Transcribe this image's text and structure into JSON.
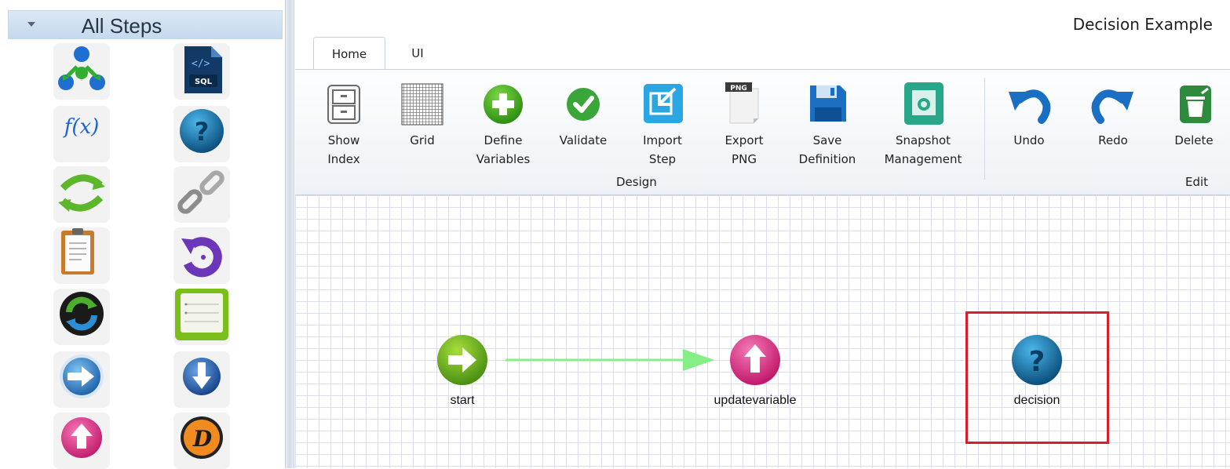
{
  "sidebar": {
    "header_title": "All Steps",
    "items": [
      {
        "icon": "hierarchy-icon"
      },
      {
        "icon": "sql-file-icon"
      },
      {
        "icon": "function-fx-icon",
        "text": "f(x)"
      },
      {
        "icon": "question-decision-icon"
      },
      {
        "icon": "loop-arrows-icon"
      },
      {
        "icon": "chain-link-icon"
      },
      {
        "icon": "clipboard-icon"
      },
      {
        "icon": "undo-rotate-icon"
      },
      {
        "icon": "sync-icon"
      },
      {
        "icon": "list-icon"
      },
      {
        "icon": "forward-arrow-icon"
      },
      {
        "icon": "down-arrow-icon"
      },
      {
        "icon": "up-arrow-icon"
      },
      {
        "icon": "d-badge-icon",
        "text": "D"
      }
    ],
    "sql_badge": "SQL"
  },
  "document": {
    "title": "Decision Example"
  },
  "tabs": [
    {
      "label": "Home",
      "active": true
    },
    {
      "label": "UI",
      "active": false
    }
  ],
  "ribbon": {
    "design_group_label": "Design",
    "edit_group_label": "Edit",
    "buttons": {
      "show_index": "Show\nIndex",
      "grid": "Grid",
      "define_variables": "Define\nVariables",
      "validate": "Validate",
      "import_step": "Import\nStep",
      "export_png": "Export\nPNG",
      "save_definition": "Save\nDefinition",
      "snapshot_management": "Snapshot\nManagement",
      "undo": "Undo",
      "redo": "Redo",
      "delete": "Delete"
    },
    "png_badge": "PNG"
  },
  "canvas": {
    "nodes": [
      {
        "label": "start",
        "icon": "start-arrow-icon"
      },
      {
        "label": "updatevariable",
        "icon": "up-arrow-icon"
      },
      {
        "label": "decision",
        "icon": "question-decision-icon",
        "selected": true
      }
    ]
  },
  "colors": {
    "accent_blue": "#1a6fc2",
    "selection_red": "#d81e2a",
    "connector_green": "#86ee86",
    "start_green": "#5aa21c",
    "update_pink": "#e8338a",
    "decision_blue": "#0e5d8c"
  }
}
